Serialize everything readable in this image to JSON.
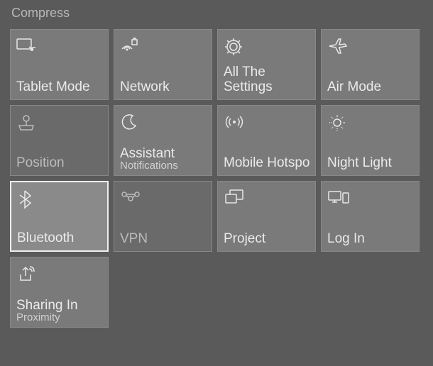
{
  "header": "Compress",
  "tiles": {
    "tablet": {
      "label": "Tablet Mode"
    },
    "network": {
      "label": "Network"
    },
    "settings": {
      "label": "All The Settings"
    },
    "airmode": {
      "label": "Air Mode"
    },
    "position": {
      "label": "Position"
    },
    "assistant": {
      "label": "Assistant",
      "sublabel": "Notifications"
    },
    "hotspot": {
      "label": "Mobile Hotspot"
    },
    "nightlight": {
      "label": "Night Light"
    },
    "bluetooth": {
      "label": "Bluetooth"
    },
    "vpn": {
      "label": "VPN"
    },
    "project": {
      "label": "Project"
    },
    "login": {
      "label": "Log In"
    },
    "sharing": {
      "label": "Sharing In",
      "sublabel": "Proximity"
    }
  }
}
